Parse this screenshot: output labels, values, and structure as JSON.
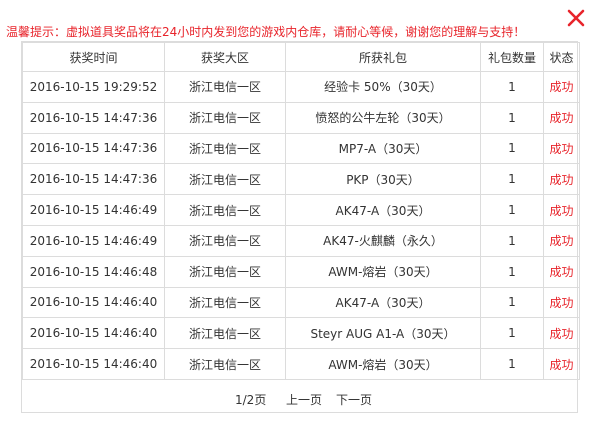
{
  "notice": "温馨提示：虚拟道具奖品将在24小时内发到您的游戏内仓库，请耐心等候，谢谢您的理解与支持！",
  "colors": {
    "accent": "#e8242b",
    "border": "#dcdcdc",
    "text": "#333333"
  },
  "close_icon": "close-x-icon",
  "table": {
    "headers": [
      "获奖时间",
      "获奖大区",
      "所获礼包",
      "礼包数量",
      "状态"
    ],
    "rows": [
      [
        "2016-10-15 19:29:52",
        "浙江电信一区",
        "经验卡 50%（30天）",
        "1",
        "成功"
      ],
      [
        "2016-10-15 14:47:36",
        "浙江电信一区",
        "愤怒的公牛左轮（30天）",
        "1",
        "成功"
      ],
      [
        "2016-10-15 14:47:36",
        "浙江电信一区",
        "MP7-A（30天）",
        "1",
        "成功"
      ],
      [
        "2016-10-15 14:47:36",
        "浙江电信一区",
        "PKP（30天）",
        "1",
        "成功"
      ],
      [
        "2016-10-15 14:46:49",
        "浙江电信一区",
        "AK47-A（30天）",
        "1",
        "成功"
      ],
      [
        "2016-10-15 14:46:49",
        "浙江电信一区",
        "AK47-火麒麟（永久）",
        "1",
        "成功"
      ],
      [
        "2016-10-15 14:46:48",
        "浙江电信一区",
        "AWM-熔岩（30天）",
        "1",
        "成功"
      ],
      [
        "2016-10-15 14:46:40",
        "浙江电信一区",
        "AK47-A（30天）",
        "1",
        "成功"
      ],
      [
        "2016-10-15 14:46:40",
        "浙江电信一区",
        "Steyr AUG A1-A（30天）",
        "1",
        "成功"
      ],
      [
        "2016-10-15 14:46:40",
        "浙江电信一区",
        "AWM-熔岩（30天）",
        "1",
        "成功"
      ]
    ]
  },
  "pager": {
    "indicator": "1/2页",
    "prev": "上一页",
    "next": "下一页"
  }
}
